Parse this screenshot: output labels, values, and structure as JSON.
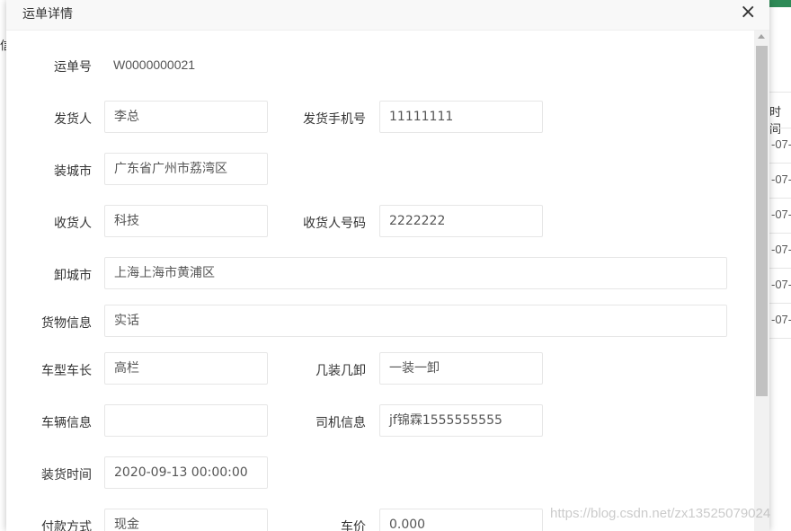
{
  "background": {
    "left_glyph": "信",
    "column_header": "时间",
    "cells": [
      "-07-",
      "-07-",
      "-07-",
      "-07-",
      "-07-",
      "-07-"
    ]
  },
  "dialog": {
    "title": "运单详情",
    "close_icon": "×"
  },
  "waybill": {
    "number_label": "运单号",
    "number_value": "W0000000021"
  },
  "form": {
    "shipper_label": "发货人",
    "shipper_value": "李总",
    "shipper_phone_label": "发货手机号",
    "shipper_phone_value": "11111111",
    "loading_city_label": "装城市",
    "loading_city_value": "广东省广州市荔湾区",
    "receiver_label": "收货人",
    "receiver_value": "科技",
    "receiver_phone_label": "收货人号码",
    "receiver_phone_value": "2222222",
    "unloading_city_label": "卸城市",
    "unloading_city_value": "上海上海市黄浦区",
    "cargo_label": "货物信息",
    "cargo_value": "实话",
    "vehicle_type_label": "车型车长",
    "vehicle_type_value": "高栏",
    "load_unload_label": "几装几卸",
    "load_unload_value": "一装一卸",
    "vehicle_info_label": "车辆信息",
    "vehicle_info_value": "",
    "driver_label": "司机信息",
    "driver_value": "jf锦霖1555555555",
    "load_time_label": "装货时间",
    "load_time_value": "2020-09-13 00:00:00",
    "payment_label": "付款方式",
    "payment_value": "现金",
    "price_label": "车价",
    "price_value": "0.000"
  },
  "watermark": "https://blog.csdn.net/zx13525079024"
}
